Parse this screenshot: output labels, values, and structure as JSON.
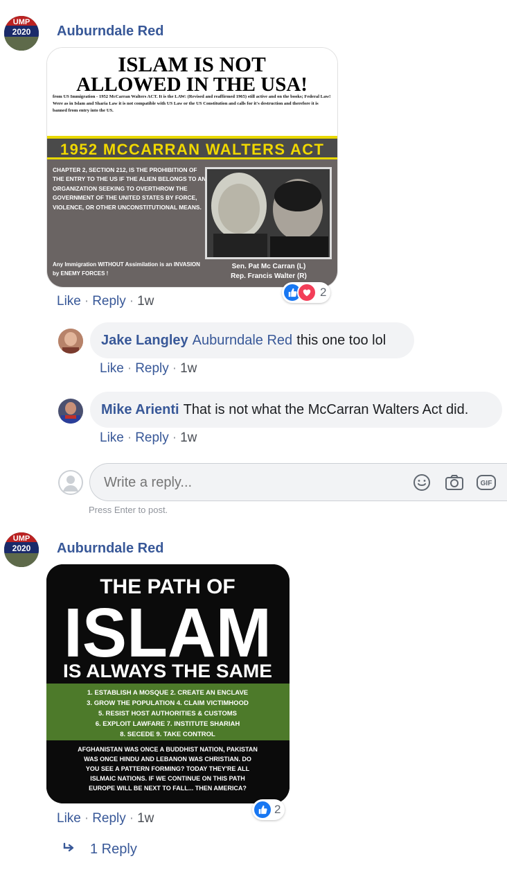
{
  "comment1": {
    "author": "Auburndale Red",
    "avatar_text": [
      "UMP",
      "2020"
    ],
    "image": {
      "headline_line1": "ISLAM IS NOT",
      "headline_line2": "ALLOWED IN THE USA!",
      "subtext": "from US Immigration - 1952 McCarran Walters ACT. It is the LAW: (Revised and reaffirmed 1965) still active and on the books; Federal Law! Were as in Islam and Sharia Law it is not compatible with US Law or the US Constitution and calls for it's destruction and therefore it is banned from entry into the US.",
      "banner": "1952 MCCARRAN WALTERS ACT",
      "chapter_text": "CHAPTER 2, SECTION 212, IS THE PROHIBITION OF THE ENTRY TO THE US IF THE ALIEN BELONGS TO AN ORGANIZATION SEEKING TO OVERTHROW THE GOVERNMENT OF THE UNITED STATES BY FORCE, VIOLENCE, OR OTHER UNCONSTITUTIONAL MEANS.",
      "footer_text": "Any Immigration WITHOUT Assimilation is an INVASION by ENEMY FORCES !",
      "caption_line1": "Sen. Pat Mc Carran (L)",
      "caption_line2": "Rep. Francis Walter (R)"
    },
    "actions": {
      "like": "Like",
      "reply": "Reply",
      "time": "1w"
    },
    "reaction_count": "2"
  },
  "reply1": {
    "author": "Jake Langley",
    "mention": "Auburndale Red",
    "text": "this one too lol",
    "actions": {
      "like": "Like",
      "reply": "Reply",
      "time": "1w"
    }
  },
  "reply2": {
    "author": "Mike Arienti",
    "text": "That is not what the McCarran Walters Act did.",
    "actions": {
      "like": "Like",
      "reply": "Reply",
      "time": "1w"
    }
  },
  "reply_box": {
    "placeholder": "Write a reply...",
    "hint": "Press Enter to post.",
    "gif_label": "GIF"
  },
  "comment2": {
    "author": "Auburndale Red",
    "avatar_text": [
      "UMP",
      "2020"
    ],
    "image": {
      "line1": "THE PATH OF",
      "line2": "ISLAM",
      "line3": "IS ALWAYS THE SAME",
      "steps": [
        "1. ESTABLISH A MOSQUE   2. CREATE AN ENCLAVE",
        "3. GROW THE POPULATION   4. CLAIM VICTIMHOOD",
        "5. RESIST HOST AUTHORITIES & CUSTOMS",
        "6. EXPLOIT LAWFARE   7. INSTITUTE SHARIAH",
        "8. SECEDE   9. TAKE CONTROL"
      ],
      "bottom": [
        "AFGHANISTAN WAS ONCE A BUDDHIST NATION, PAKISTAN",
        "WAS ONCE HINDU AND LEBANON WAS CHRISTIAN.  DO",
        "YOU SEE A PATTERN FORMING?  TODAY THEY'RE ALL",
        "ISLMAIC NATIONS.  IF WE CONTINUE ON THIS PATH",
        "EUROPE WILL BE NEXT TO FALL... THEN AMERICA?"
      ]
    },
    "actions": {
      "like": "Like",
      "reply": "Reply",
      "time": "1w"
    },
    "reaction_count": "2",
    "replies_link": "1 Reply"
  },
  "colors": {
    "link": "#385898",
    "like_blue": "#1877f2",
    "love_red": "#f33e58",
    "bubble": "#f2f3f5"
  }
}
